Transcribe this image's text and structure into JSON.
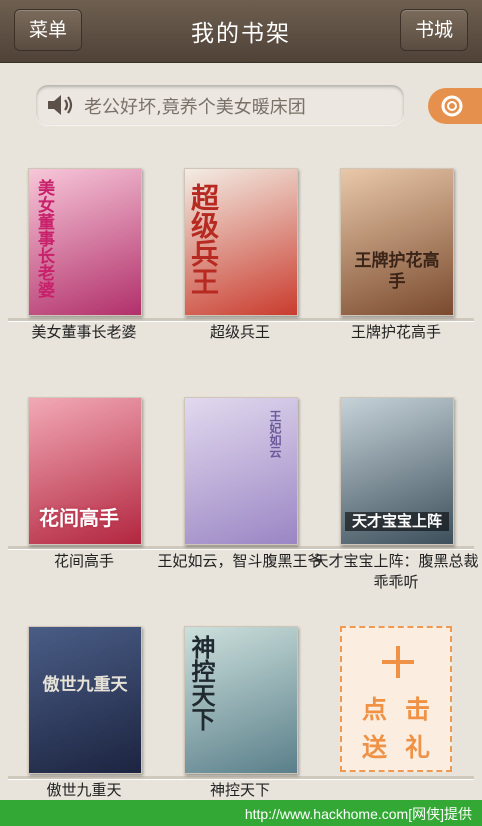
{
  "header": {
    "menu_label": "菜单",
    "title": "我的书架",
    "store_label": "书城"
  },
  "search": {
    "text": "老公好坏,竟养个美女暖床团",
    "icon": "speaker-icon",
    "button_icon": "search-icon"
  },
  "books": [
    {
      "title": "美女董事长老婆",
      "cover_text": "美女董事长老婆",
      "cover_colors": [
        "#f7c7d9",
        "#b1306a"
      ]
    },
    {
      "title": "超级兵王",
      "cover_text": "超级兵王",
      "cover_colors": [
        "#f3ede4",
        "#c93c2e"
      ]
    },
    {
      "title": "王牌护花高手",
      "cover_text": "王牌护花高手",
      "cover_colors": [
        "#e9c8a9",
        "#7a4a2e"
      ]
    },
    {
      "title": "花间高手",
      "cover_text": "花间高手",
      "cover_colors": [
        "#f2a9b6",
        "#b2263f"
      ]
    },
    {
      "title": "王妃如云，智斗腹黑王爷",
      "cover_text": "王妃如云",
      "cover_colors": [
        "#e2d9ee",
        "#9a86c4"
      ]
    },
    {
      "title": "天才宝宝上阵：腹黑总裁乖乖听",
      "cover_text": "天才宝宝上阵",
      "cover_colors": [
        "#c6d2d8",
        "#3c4f5b"
      ]
    },
    {
      "title": "傲世九重天",
      "cover_text": "傲世九重天",
      "cover_colors": [
        "#4a5d86",
        "#1c2440"
      ]
    },
    {
      "title": "神控天下",
      "cover_text": "神控天下",
      "cover_colors": [
        "#cde0dc",
        "#5a7f8a"
      ]
    }
  ],
  "add_card": {
    "line1": "点击",
    "line2": "送礼"
  },
  "footer": {
    "text": "http://www.hackhome.com[网侠]提供"
  },
  "colors": {
    "header": "#5e5044",
    "background": "#e8e4dc",
    "accent": "#ef9245",
    "footer": "#33a834"
  }
}
